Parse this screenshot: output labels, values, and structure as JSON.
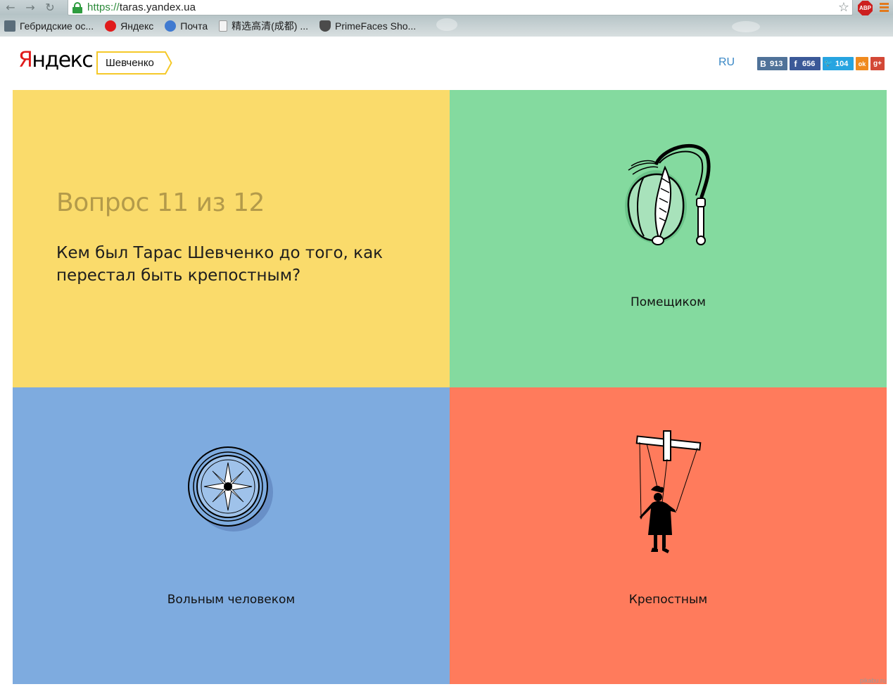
{
  "browser": {
    "url_scheme": "https://",
    "url_host": "taras.yandex.ua",
    "abp_label": "ABP",
    "bookmarks": [
      {
        "label": "Гебридские ос...",
        "icon": "bookmark-page-icon"
      },
      {
        "label": "Яндекс",
        "icon": "yandex-icon"
      },
      {
        "label": "Почта",
        "icon": "mail-icon"
      },
      {
        "label": "精选高清(成都) ...",
        "icon": "document-icon"
      },
      {
        "label": "PrimeFaces Sho...",
        "icon": "primefaces-icon"
      }
    ]
  },
  "header": {
    "logo_first": "Я",
    "logo_rest": "ндекс",
    "breadcrumb": "Шевченко",
    "lang": "RU",
    "shares": {
      "vk": {
        "glyph": "В",
        "count": "913"
      },
      "fb": {
        "glyph": "f",
        "count": "656"
      },
      "tw": {
        "glyph": "🐦",
        "count": "104"
      },
      "ok": {
        "glyph": "ok"
      },
      "gp": {
        "glyph": "g+"
      }
    }
  },
  "quiz": {
    "counter": "Вопрос 11 из 12",
    "question": "Кем был Тарас Шевченко до того, как перестал быть крепостным?",
    "answers": [
      {
        "label": "Помещиком",
        "icon": "landlord-whip-icon",
        "color": "#84da9f"
      },
      {
        "label": "Вольным человеком",
        "icon": "compass-icon",
        "color": "#7eabdf"
      },
      {
        "label": "Крепостным",
        "icon": "marionette-icon",
        "color": "#ff7b5c"
      }
    ],
    "question_color": "#fadb6b"
  },
  "watermark": "pikabu.ru"
}
